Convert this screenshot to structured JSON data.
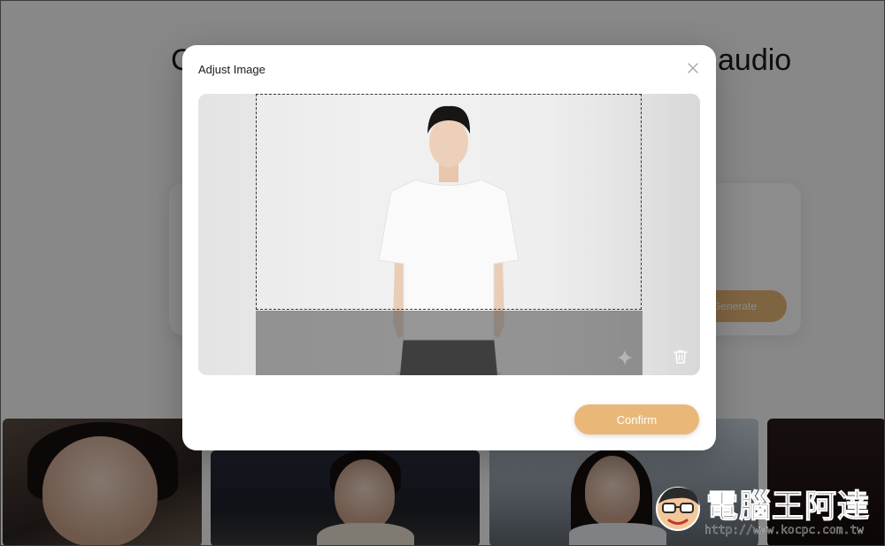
{
  "background": {
    "heading_left": "C",
    "heading_right": "audio",
    "generate_button_label": "Generate"
  },
  "modal": {
    "title": "Adjust Image",
    "close_icon": "close-icon",
    "confirm_label": "Confirm",
    "delete_icon": "trash-icon",
    "sparkle_icon": "sparkle-icon"
  },
  "watermark": {
    "title": "電腦王阿達",
    "url": "http://www.kocpc.com.tw"
  },
  "colors": {
    "accent": "#e9b878",
    "overlay": "rgba(0,0,0,0.45)"
  }
}
